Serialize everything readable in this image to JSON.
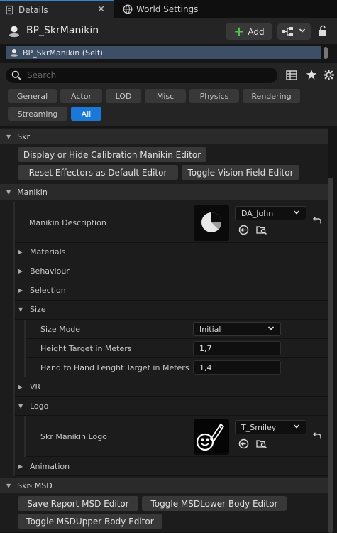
{
  "tabs": [
    {
      "label": "Details",
      "close": "✕"
    },
    {
      "label": "World Settings"
    }
  ],
  "header": {
    "title": "BP_SkrManikin",
    "add_label": "Add"
  },
  "selection": {
    "label": "BP_SkrManikin (Self)"
  },
  "search": {
    "placeholder": "Search"
  },
  "filters": [
    "General",
    "Actor",
    "LOD",
    "Misc",
    "Physics",
    "Rendering",
    "Streaming",
    "All"
  ],
  "filter_selected": "All",
  "sections": {
    "skr": {
      "title": "Skr",
      "buttons": [
        "Display or Hide Calibration Manikin Editor",
        "Reset Effectors as Default Editor",
        "Toggle Vision Field Editor"
      ]
    },
    "manikin": {
      "title": "Manikin",
      "description_label": "Manikin Description",
      "description_asset": "DA_John",
      "materials": "Materials",
      "behaviour": "Behaviour",
      "selection": "Selection",
      "size": {
        "title": "Size",
        "size_mode_label": "Size Mode",
        "size_mode_value": "Initial",
        "height_label": "Height Target in Meters",
        "height_value": "1,7",
        "hand_label": "Hand to Hand Lenght Target in Meters",
        "hand_value": "1,4"
      },
      "vr": "VR",
      "logo": {
        "title": "Logo",
        "logo_label": "Skr Manikin Logo",
        "logo_asset": "T_Smiley"
      },
      "animation": "Animation"
    },
    "msd": {
      "title": "Skr- MSD",
      "buttons": [
        "Save Report MSD Editor",
        "Toggle MSDLower Body Editor",
        "Toggle MSDUpper Body Editor"
      ]
    }
  },
  "colors": {
    "accent": "#1a78d8",
    "add_icon": "#4fc24f",
    "thumb_underline": "#c6234f",
    "selection_row": "#3c4f66"
  }
}
